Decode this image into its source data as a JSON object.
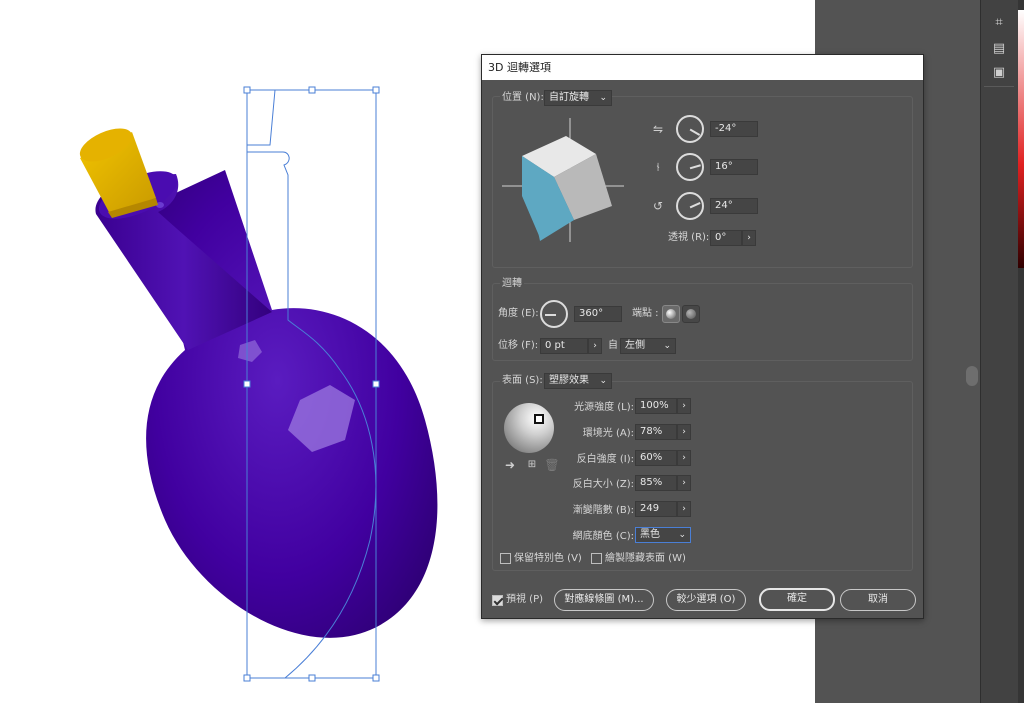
{
  "dialog": {
    "title": "3D 迴轉選項",
    "position": {
      "label": "位置 (N):",
      "preset": "自訂旋轉",
      "rot_x": "-24°",
      "rot_y": "16°",
      "rot_z": "24°",
      "perspective_label": "透視 (R):",
      "perspective_value": "0°"
    },
    "revolve": {
      "section": "迴轉",
      "angle_label": "角度 (E):",
      "angle_value": "360°",
      "cap_label": "端點 :",
      "offset_label": "位移 (F):",
      "offset_value": "0 pt",
      "from_label": "自",
      "from_value": "左側"
    },
    "surface": {
      "label": "表面 (S):",
      "value": "塑膠效果",
      "light_intensity_label": "光源強度 (L):",
      "light_intensity": "100%",
      "ambient_label": "環境光 (A):",
      "ambient": "78%",
      "highlight_intensity_label": "反白強度 (I):",
      "highlight_intensity": "60%",
      "highlight_size_label": "反白大小 (Z):",
      "highlight_size": "85%",
      "blend_steps_label": "漸變階數 (B):",
      "blend_steps": "249",
      "shade_color_label": "網底顏色 (C):",
      "shade_color": "黑色",
      "preserve_spot_label": "保留特別色 (V)",
      "draw_hidden_label": "繪製隱藏表面 (W)"
    },
    "footer": {
      "preview_label": "預視 (P)",
      "map_art_label": "對應線條圖 (M)...",
      "fewer_options_label": "較少選項 (O)",
      "ok_label": "確定",
      "cancel_label": "取消"
    }
  },
  "colors": {
    "bottle": "#3f0096",
    "cork": "#e8b800",
    "cube_front": "#5ea8c2",
    "dialog_bg": "#535353",
    "selection": "#4a7fd6"
  },
  "icons": [
    "rotate-x-icon",
    "rotate-y-icon",
    "rotate-z-icon",
    "chevron-right-icon",
    "chevron-down-icon",
    "move-light-icon",
    "new-light-icon",
    "delete-light-icon",
    "transform-icon",
    "align-icon",
    "gradient-icon"
  ]
}
